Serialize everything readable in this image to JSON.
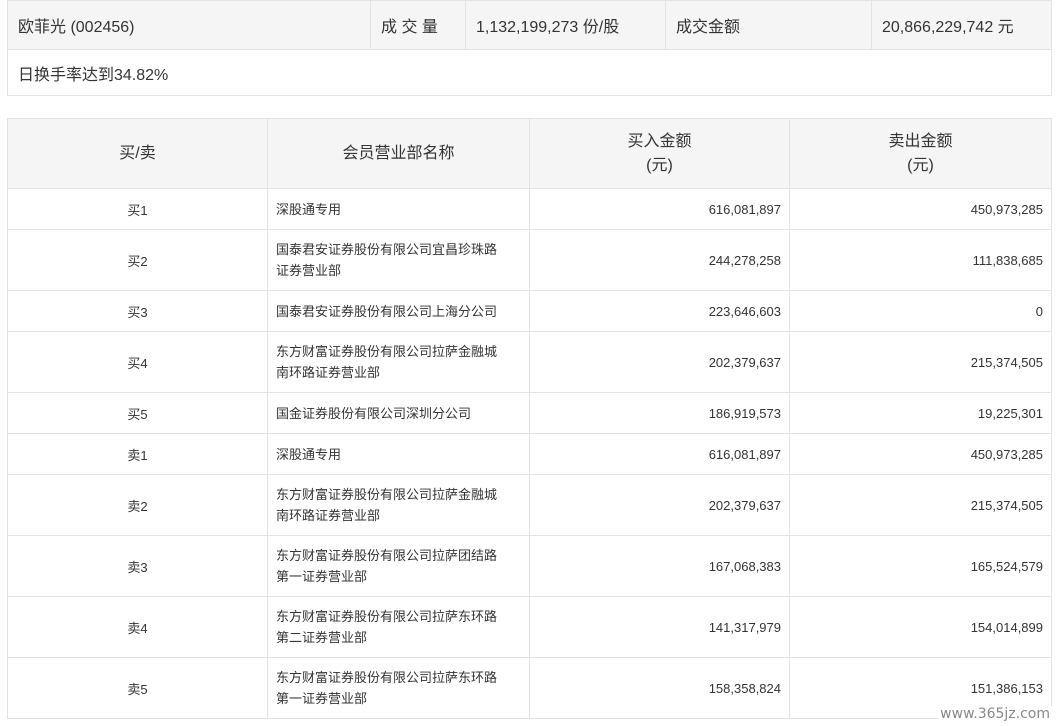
{
  "summary": {
    "stock": "欧菲光 (002456)",
    "volume_label": "成 交 量",
    "volume_value": "1,132,199,273 份/股",
    "amount_label": "成交金额",
    "amount_value": "20,866,229,742 元",
    "turnover_note": "日换手率达到34.82%"
  },
  "table": {
    "headers": {
      "side": "买/卖",
      "broker": "会员营业部名称",
      "buy_line1": "买入金额",
      "buy_line2": "(元)",
      "sell_line1": "卖出金额",
      "sell_line2": "(元)"
    },
    "rows": [
      {
        "side": "买1",
        "line1": "深股通专用",
        "line2": "",
        "buy": "616,081,897",
        "sell": "450,973,285"
      },
      {
        "side": "买2",
        "line1": "国泰君安证券股份有限公司宜昌珍珠路",
        "line2": "证券营业部",
        "buy": "244,278,258",
        "sell": "111,838,685"
      },
      {
        "side": "买3",
        "line1": "国泰君安证券股份有限公司上海分公司",
        "line2": "",
        "buy": "223,646,603",
        "sell": "0"
      },
      {
        "side": "买4",
        "line1": "东方财富证券股份有限公司拉萨金融城",
        "line2": "南环路证券营业部",
        "buy": "202,379,637",
        "sell": "215,374,505"
      },
      {
        "side": "买5",
        "line1": "国金证券股份有限公司深圳分公司",
        "line2": "",
        "buy": "186,919,573",
        "sell": "19,225,301"
      },
      {
        "side": "卖1",
        "line1": "深股通专用",
        "line2": "",
        "buy": "616,081,897",
        "sell": "450,973,285"
      },
      {
        "side": "卖2",
        "line1": "东方财富证券股份有限公司拉萨金融城",
        "line2": "南环路证券营业部",
        "buy": "202,379,637",
        "sell": "215,374,505"
      },
      {
        "side": "卖3",
        "line1": "东方财富证券股份有限公司拉萨团结路",
        "line2": "第一证券营业部",
        "buy": "167,068,383",
        "sell": "165,524,579"
      },
      {
        "side": "卖4",
        "line1": "东方财富证券股份有限公司拉萨东环路",
        "line2": "第二证券营业部",
        "buy": "141,317,979",
        "sell": "154,014,899"
      },
      {
        "side": "卖5",
        "line1": "东方财富证券股份有限公司拉萨东环路",
        "line2": "第一证券营业部",
        "buy": "158,358,824",
        "sell": "151,386,153"
      }
    ]
  },
  "watermark": "www.365jz.com"
}
